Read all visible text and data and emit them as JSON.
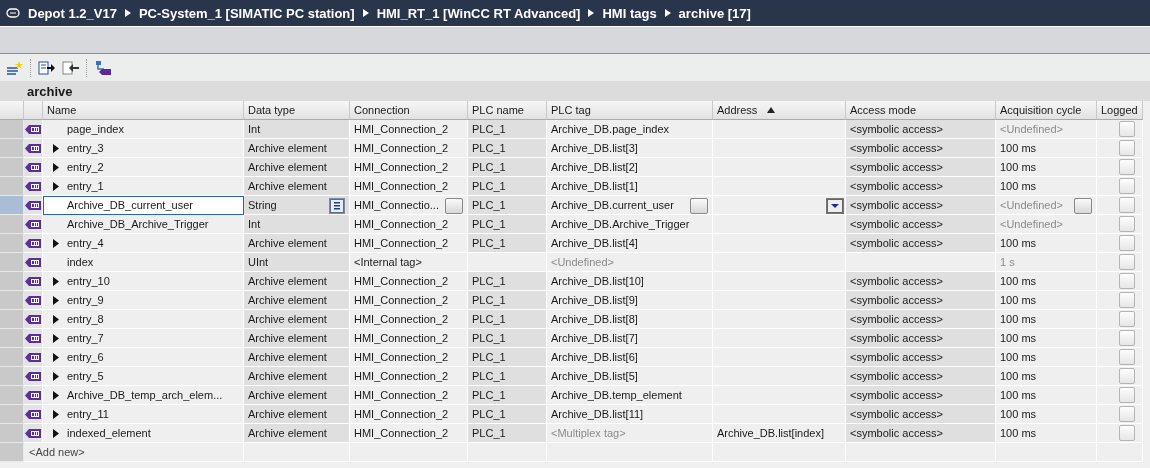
{
  "breadcrumb": [
    "Depot 1.2_V17",
    "PC-System_1 [SIMATIC PC station]",
    "HMI_RT_1 [WinCC RT Advanced]",
    "HMI tags",
    "archive [17]"
  ],
  "table": {
    "title": "archive",
    "columns": [
      {
        "label": "Name"
      },
      {
        "label": "Data type"
      },
      {
        "label": "Connection"
      },
      {
        "label": "PLC name"
      },
      {
        "label": "PLC tag"
      },
      {
        "label": "Address",
        "sorted": true
      },
      {
        "label": "Access mode"
      },
      {
        "label": "Acquisition cycle"
      },
      {
        "label": "Logged"
      }
    ],
    "rows": [
      {
        "name": "page_index",
        "expandable": false,
        "selected": false,
        "data_type": "Int",
        "connection": "HMI_Connection_2",
        "plc_name": "PLC_1",
        "plc_tag": "Archive_DB.page_index",
        "access_mode": "<symbolic access>",
        "acquisition_cycle": {
          "text": "<Undefined>",
          "dimmed": true
        },
        "logged": false
      },
      {
        "name": "entry_3",
        "expandable": true,
        "selected": false,
        "data_type": "Archive element",
        "connection": "HMI_Connection_2",
        "plc_name": "PLC_1",
        "plc_tag": "Archive_DB.list[3]",
        "access_mode": "<symbolic access>",
        "acquisition_cycle": "100 ms",
        "logged": false
      },
      {
        "name": "entry_2",
        "expandable": true,
        "selected": false,
        "data_type": "Archive element",
        "connection": "HMI_Connection_2",
        "plc_name": "PLC_1",
        "plc_tag": "Archive_DB.list[2]",
        "access_mode": "<symbolic access>",
        "acquisition_cycle": "100 ms",
        "logged": false
      },
      {
        "name": "entry_1",
        "expandable": true,
        "selected": false,
        "data_type": "Archive element",
        "connection": "HMI_Connection_2",
        "plc_name": "PLC_1",
        "plc_tag": "Archive_DB.list[1]",
        "access_mode": "<symbolic access>",
        "acquisition_cycle": "100 ms",
        "logged": false
      },
      {
        "name": "Archive_DB_current_user",
        "expandable": false,
        "selected": true,
        "data_type": "String",
        "connection": "HMI_Connectio...",
        "plc_name": "PLC_1",
        "plc_tag": "Archive_DB.current_user",
        "access_mode": "<symbolic access>",
        "acquisition_cycle": {
          "text": "<Undefined>",
          "dimmed": true
        },
        "logged": false
      },
      {
        "name": "Archive_DB_Archive_Trigger",
        "expandable": false,
        "selected": false,
        "data_type": "Int",
        "connection": "HMI_Connection_2",
        "plc_name": "PLC_1",
        "plc_tag": "Archive_DB.Archive_Trigger",
        "access_mode": "<symbolic access>",
        "acquisition_cycle": {
          "text": "<Undefined>",
          "dimmed": true
        },
        "logged": false
      },
      {
        "name": "entry_4",
        "expandable": true,
        "selected": false,
        "data_type": "Archive element",
        "connection": "HMI_Connection_2",
        "plc_name": "PLC_1",
        "plc_tag": "Archive_DB.list[4]",
        "access_mode": "<symbolic access>",
        "acquisition_cycle": "100 ms",
        "logged": false
      },
      {
        "name": "index",
        "expandable": false,
        "selected": false,
        "data_type": "UInt",
        "connection": "<Internal tag>",
        "plc_tag": {
          "text": "<Undefined>",
          "dimmed": true
        },
        "acquisition_cycle": {
          "text": "1 s",
          "dimmed": true
        },
        "logged": false
      },
      {
        "name": "entry_10",
        "expandable": true,
        "selected": false,
        "data_type": "Archive element",
        "connection": "HMI_Connection_2",
        "plc_name": "PLC_1",
        "plc_tag": "Archive_DB.list[10]",
        "access_mode": "<symbolic access>",
        "acquisition_cycle": "100 ms",
        "logged": false
      },
      {
        "name": "entry_9",
        "expandable": true,
        "selected": false,
        "data_type": "Archive element",
        "connection": "HMI_Connection_2",
        "plc_name": "PLC_1",
        "plc_tag": "Archive_DB.list[9]",
        "access_mode": "<symbolic access>",
        "acquisition_cycle": "100 ms",
        "logged": false
      },
      {
        "name": "entry_8",
        "expandable": true,
        "selected": false,
        "data_type": "Archive element",
        "connection": "HMI_Connection_2",
        "plc_name": "PLC_1",
        "plc_tag": "Archive_DB.list[8]",
        "access_mode": "<symbolic access>",
        "acquisition_cycle": "100 ms",
        "logged": false
      },
      {
        "name": "entry_7",
        "expandable": true,
        "selected": false,
        "data_type": "Archive element",
        "connection": "HMI_Connection_2",
        "plc_name": "PLC_1",
        "plc_tag": "Archive_DB.list[7]",
        "access_mode": "<symbolic access>",
        "acquisition_cycle": "100 ms",
        "logged": false
      },
      {
        "name": "entry_6",
        "expandable": true,
        "selected": false,
        "data_type": "Archive element",
        "connection": "HMI_Connection_2",
        "plc_name": "PLC_1",
        "plc_tag": "Archive_DB.list[6]",
        "access_mode": "<symbolic access>",
        "acquisition_cycle": "100 ms",
        "logged": false
      },
      {
        "name": "entry_5",
        "expandable": true,
        "selected": false,
        "data_type": "Archive element",
        "connection": "HMI_Connection_2",
        "plc_name": "PLC_1",
        "plc_tag": "Archive_DB.list[5]",
        "access_mode": "<symbolic access>",
        "acquisition_cycle": "100 ms",
        "logged": false
      },
      {
        "name": "Archive_DB_temp_arch_elem...",
        "expandable": true,
        "selected": false,
        "data_type": "Archive element",
        "connection": "HMI_Connection_2",
        "plc_name": "PLC_1",
        "plc_tag": "Archive_DB.temp_element",
        "access_mode": "<symbolic access>",
        "acquisition_cycle": "100 ms",
        "logged": false
      },
      {
        "name": "entry_11",
        "expandable": true,
        "selected": false,
        "data_type": "Archive element",
        "connection": "HMI_Connection_2",
        "plc_name": "PLC_1",
        "plc_tag": "Archive_DB.list[11]",
        "access_mode": "<symbolic access>",
        "acquisition_cycle": "100 ms",
        "logged": false
      },
      {
        "name": "indexed_element",
        "expandable": true,
        "selected": false,
        "data_type": "Archive element",
        "connection": "HMI_Connection_2",
        "plc_name": "PLC_1",
        "plc_tag": {
          "text": "<Multiplex tag>",
          "dimmed": true
        },
        "address": "Archive_DB.list[index]",
        "access_mode": "<symbolic access>",
        "acquisition_cycle": "100 ms",
        "logged": false
      }
    ],
    "add_new": "<Add new>"
  }
}
